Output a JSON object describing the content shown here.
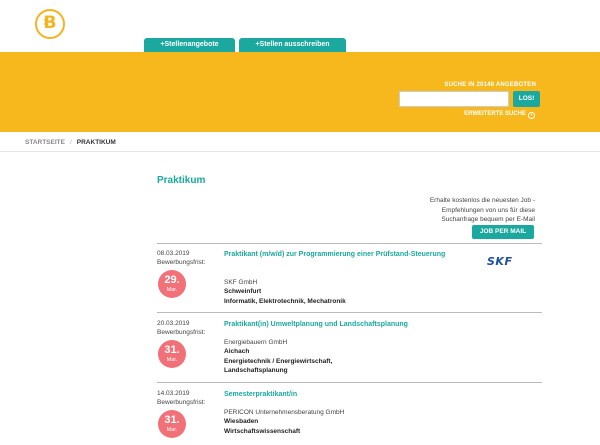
{
  "header": {
    "logo_letter": "B",
    "tabs": [
      {
        "label": "+Stellenangebote"
      },
      {
        "label": "+Stellen ausschreiben"
      }
    ]
  },
  "search": {
    "label": "SUCHE IN 20148 ANGEBOTEN",
    "input_value": "",
    "button_label": "LOS!",
    "advanced_label": "ERWEITERTE SUCHE",
    "advanced_icon": "circle-chevron-icon"
  },
  "breadcrumb": {
    "items": [
      "STARTSEITE",
      "PRAKTIKUM"
    ],
    "separator": "/"
  },
  "main": {
    "title": "Praktikum",
    "promo_text": "Erhalte kostenlos die neuesten Job - Empfehlungen von uns für diese Suchanfrage bequem per E-Mail",
    "job_mail_label": "JOB PER MAIL"
  },
  "jobs": [
    {
      "date": "08.03.2019",
      "frist_label": "Bewerbungsfrist:",
      "deadline_day": "29.",
      "deadline_month": "Mar.",
      "title": "Praktikant (m/w/d) zur Programmierung einer Prüfstand-Steuerung",
      "company": "SKF GmbH",
      "place": "Schweinfurt",
      "field": "Informatik, Elektrotechnik, Mechatronik",
      "logo_text": "SKF"
    },
    {
      "date": "20.03.2019",
      "frist_label": "Bewerbungsfrist:",
      "deadline_day": "31.",
      "deadline_month": "Mar.",
      "title": "Praktikant(in) Umweltplanung und Landschaftsplanung",
      "company": "Energiebauern GmbH",
      "place": "Aichach",
      "field": "Energietechnik / Energiewirtschaft, Landschaftsplanung"
    },
    {
      "date": "14.03.2019",
      "frist_label": "Bewerbungsfrist:",
      "deadline_day": "31.",
      "deadline_month": "Mar.",
      "title": "Semesterpraktikant/in",
      "company": "PERICON Unternehmensberatung GmbH",
      "place": "Wiesbaden",
      "field": "Wirtschaftswissenschaft"
    }
  ],
  "colors": {
    "accent": "#1aa89f",
    "brand_yellow": "#f7b81e",
    "deadline": "#f27077"
  }
}
